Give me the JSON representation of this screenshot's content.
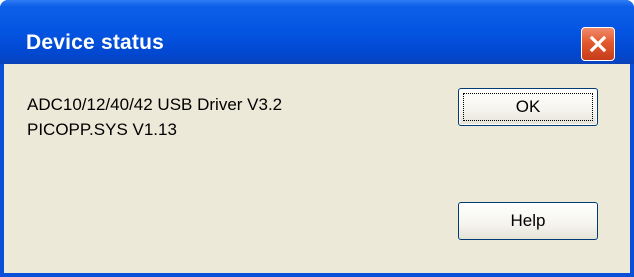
{
  "window": {
    "title": "Device status",
    "close_icon": "close-x-icon"
  },
  "info": {
    "line1": "ADC10/12/40/42 USB Driver V3.2",
    "line2": "PICOPP.SYS V1.13"
  },
  "buttons": {
    "ok_label": "OK",
    "help_label": "Help"
  },
  "colors": {
    "titlebar": "#0454e2",
    "client": "#ece9d8",
    "close_button": "#e2592f"
  }
}
